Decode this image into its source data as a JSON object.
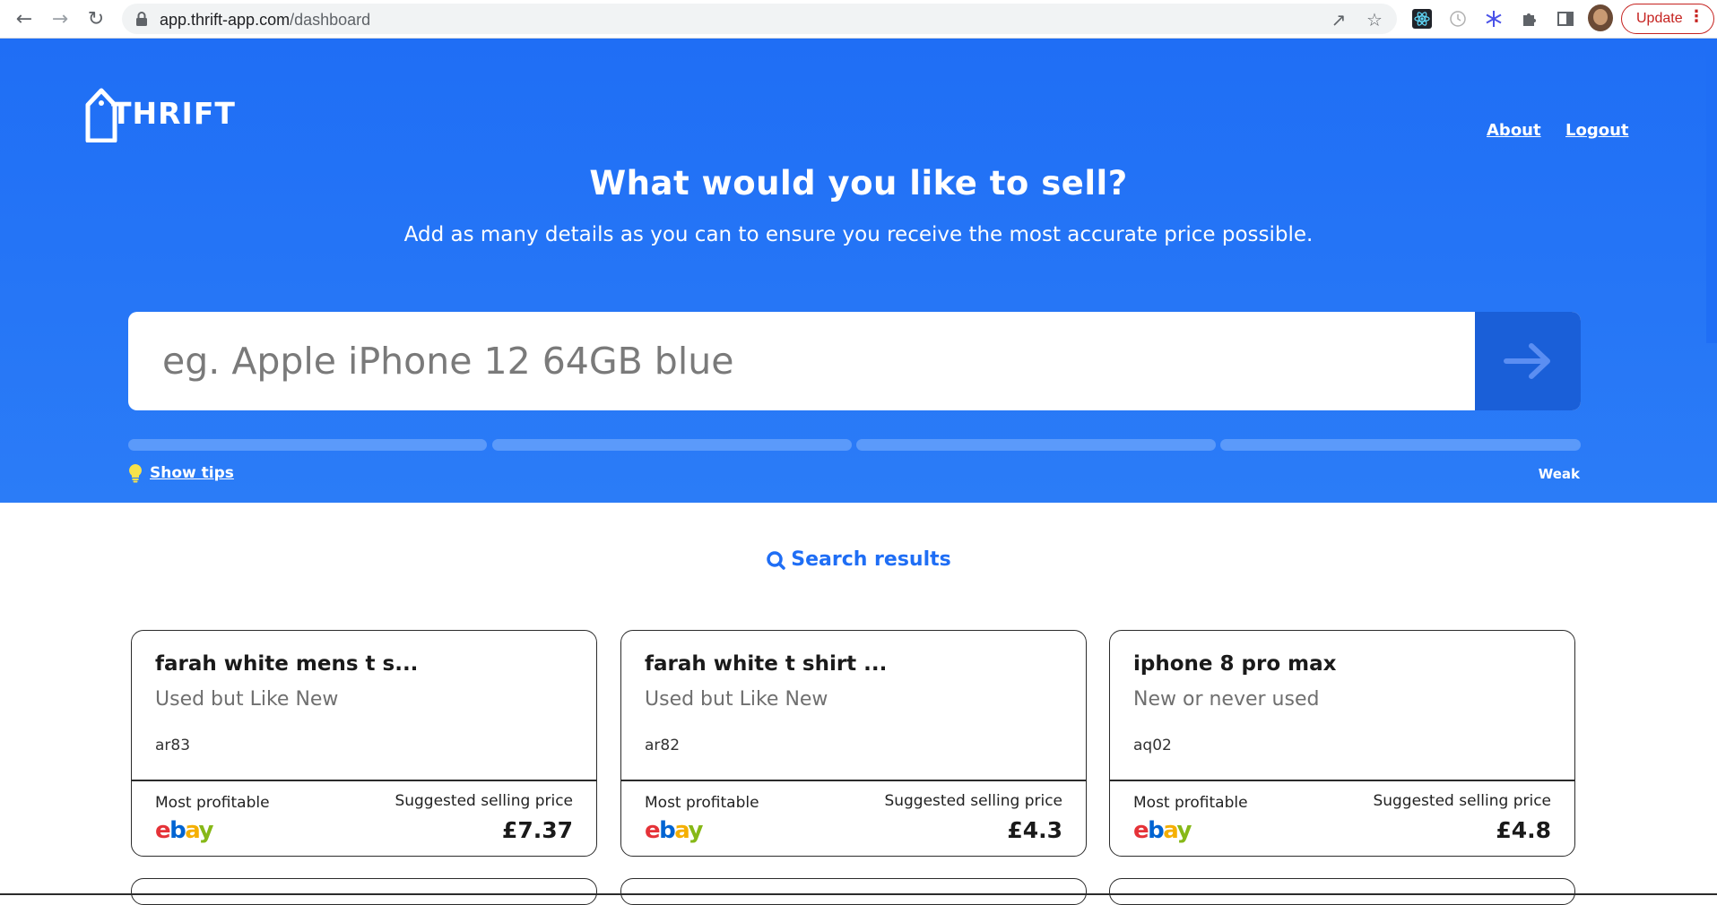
{
  "browser": {
    "url_host": "app.thrift-app.com",
    "url_path": "/dashboard",
    "update_label": "Update",
    "icons": [
      "back-icon",
      "forward-icon",
      "reload-icon",
      "lock-icon",
      "share-icon",
      "star-icon",
      "extension-icons",
      "puzzle-icon",
      "sidepanel-icon",
      "avatar",
      "menu-icon"
    ]
  },
  "header": {
    "logo_text": "THRIFT",
    "nav": {
      "about": "About",
      "logout": "Logout"
    }
  },
  "hero": {
    "title": "What would you like to sell?",
    "subtitle": "Add as many details as you can to ensure you receive the most accurate price possible.",
    "search_placeholder": "eg. Apple iPhone 12 64GB blue",
    "tips_label": "Show tips",
    "strength_label": "Weak"
  },
  "results": {
    "heading": "Search results",
    "cards": [
      {
        "title": "farah white mens t s...",
        "condition": "Used but Like New",
        "code": "ar83",
        "most_profitable_label": "Most profitable",
        "suggested_label": "Suggested selling price",
        "marketplace": "ebay",
        "price": "£7.37"
      },
      {
        "title": "farah white t shirt ...",
        "condition": "Used but Like New",
        "code": "ar82",
        "most_profitable_label": "Most profitable",
        "suggested_label": "Suggested selling price",
        "marketplace": "ebay",
        "price": "£4.3"
      },
      {
        "title": "iphone 8 pro max",
        "condition": "New or never used",
        "code": "aq02",
        "most_profitable_label": "Most profitable",
        "suggested_label": "Suggested selling price",
        "marketplace": "ebay",
        "price": "£4.8"
      }
    ]
  },
  "colors": {
    "brand_blue": "#1f6ef5",
    "submit_blue": "#1a5fd8",
    "ebay_e": "#e53238",
    "ebay_b": "#0064d2",
    "ebay_a": "#f5af02",
    "ebay_y": "#86b817",
    "update_red": "#c5221f"
  }
}
